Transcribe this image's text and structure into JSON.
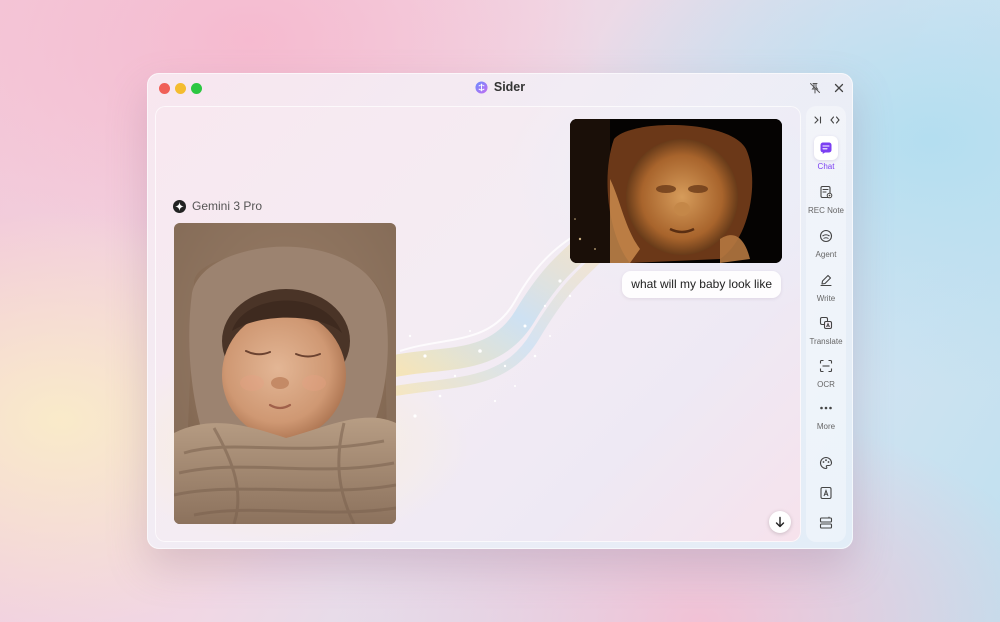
{
  "window": {
    "title": "Sider",
    "accent": "#7b3ff2"
  },
  "chat": {
    "model_name": "Gemini 3 Pro",
    "user_message": "what will my baby look like",
    "images": {
      "user_upload": "ultrasound-3d-image",
      "ai_response": "newborn-baby-image"
    }
  },
  "sidebar": {
    "items": [
      {
        "label": "Chat",
        "icon": "chat-icon",
        "active": true
      },
      {
        "label": "REC Note",
        "icon": "rec-note-icon"
      },
      {
        "label": "Agent",
        "icon": "agent-icon"
      },
      {
        "label": "Write",
        "icon": "write-icon"
      },
      {
        "label": "Translate",
        "icon": "translate-icon"
      },
      {
        "label": "OCR",
        "icon": "ocr-icon"
      },
      {
        "label": "More",
        "icon": "more-icon"
      }
    ],
    "bottom_icons": [
      "palette-icon",
      "pdf-icon",
      "layout-icon"
    ]
  }
}
